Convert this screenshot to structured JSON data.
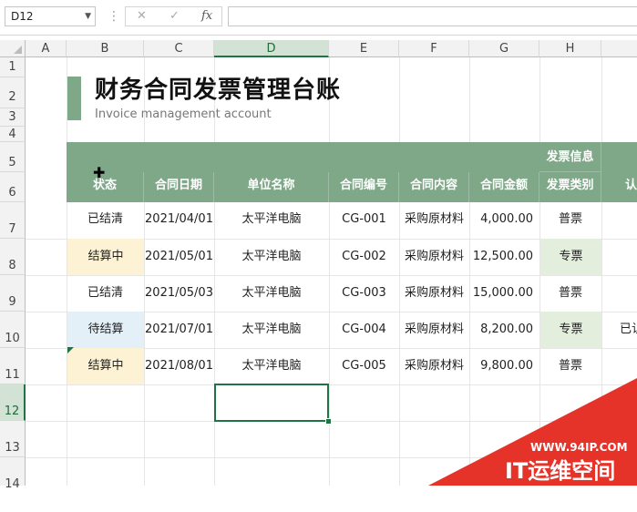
{
  "formula_bar": {
    "name_box": "D12",
    "formula": "",
    "cancel_glyph": "✕",
    "enter_glyph": "✓",
    "fx_label": "fx"
  },
  "columns": [
    "A",
    "B",
    "C",
    "D",
    "E",
    "F",
    "G",
    "H",
    ""
  ],
  "rows": [
    "1",
    "2",
    "3",
    "4",
    "5",
    "6",
    "7",
    "8",
    "9",
    "10",
    "11",
    "12",
    "13",
    "14"
  ],
  "selected_cell": "D12",
  "sheet": {
    "title": "财务合同发票管理台账",
    "subtitle": "Invoice management account",
    "group_header": "发票信息",
    "headers": [
      "状态",
      "合同日期",
      "单位名称",
      "合同编号",
      "合同内容",
      "合同金额",
      "发票类别",
      "认"
    ],
    "records": [
      {
        "status": "已结清",
        "date": "2021/04/01",
        "unit": "太平洋电脑",
        "no": "CG-001",
        "content": "采购原材料",
        "amount": "4,000.00",
        "invoice": "普票",
        "extra": ""
      },
      {
        "status": "结算中",
        "date": "2021/05/01",
        "unit": "太平洋电脑",
        "no": "CG-002",
        "content": "采购原材料",
        "amount": "12,500.00",
        "invoice": "专票",
        "extra": ""
      },
      {
        "status": "已结清",
        "date": "2021/05/03",
        "unit": "太平洋电脑",
        "no": "CG-003",
        "content": "采购原材料",
        "amount": "15,000.00",
        "invoice": "普票",
        "extra": ""
      },
      {
        "status": "待结算",
        "date": "2021/07/01",
        "unit": "太平洋电脑",
        "no": "CG-004",
        "content": "采购原材料",
        "amount": "8,200.00",
        "invoice": "专票",
        "extra": "已认"
      },
      {
        "status": "结算中",
        "date": "2021/08/01",
        "unit": "太平洋电脑",
        "no": "CG-005",
        "content": "采购原材料",
        "amount": "9,800.00",
        "invoice": "普票",
        "extra": ""
      }
    ]
  },
  "watermark": {
    "url": "WWW.94IP.COM",
    "name": "IT运维空间"
  },
  "colors": {
    "header_green": "#7fa889",
    "selection": "#217346",
    "status_yellow": "#fdf3d4",
    "status_blue": "#e3f0f8",
    "invoice_green": "#e3efdc"
  }
}
